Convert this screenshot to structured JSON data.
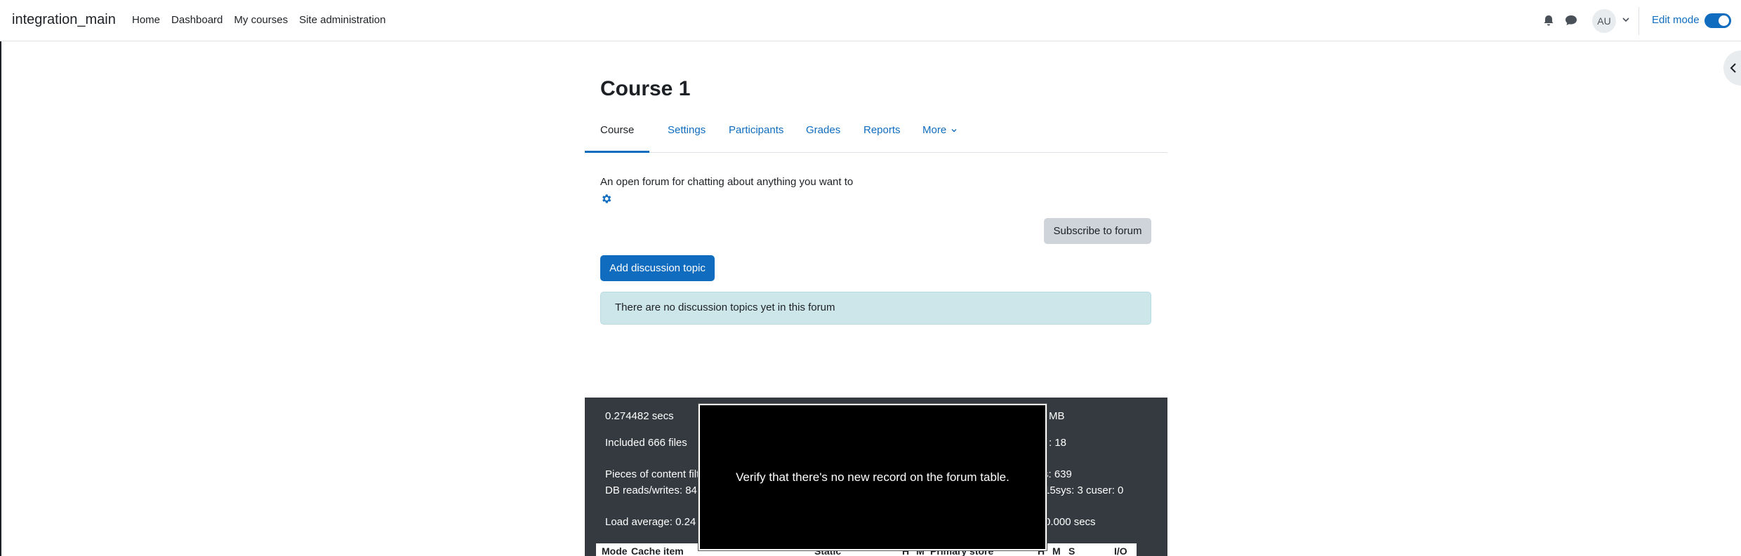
{
  "navbar": {
    "brand": "integration_main",
    "links": [
      "Home",
      "Dashboard",
      "My courses",
      "Site administration"
    ],
    "avatar_initials": "AU",
    "edit_mode_label": "Edit mode",
    "edit_mode_on": true,
    "icons": [
      "bell-icon",
      "chat-icon",
      "chevron-down-icon"
    ],
    "accent_color": "#0f6cbf"
  },
  "page": {
    "title": "Course 1",
    "tabs": [
      "Course",
      "Settings",
      "Participants",
      "Grades",
      "Reports",
      "More"
    ],
    "active_tab": "Course"
  },
  "forum": {
    "intro": "An open forum for chatting about anything you want to",
    "subscribe_label": "Subscribe to forum",
    "add_topic_label": "Add discussion topic",
    "empty_message": "There are no discussion topics yet in this forum"
  },
  "perf": {
    "time": "0.274482 secs",
    "included_files": "Included 666 files",
    "content_filters": "Pieces of content filt",
    "db_rw": "DB reads/writes: 84",
    "load_average": "Load average: 0.24",
    "right_mb": "MB",
    "right_18": ": 18",
    "right_639": "s: 639",
    "right_sys": "15sys: 3 cuser: 0",
    "right_secs": "0.000 secs",
    "table_headers": [
      "Mode",
      "Cache item",
      "Static",
      "H",
      "M",
      "Primary store",
      "H",
      "M",
      "S",
      "I/O"
    ]
  },
  "overlay": {
    "message": "Verify that there's no new record on the forum table."
  }
}
